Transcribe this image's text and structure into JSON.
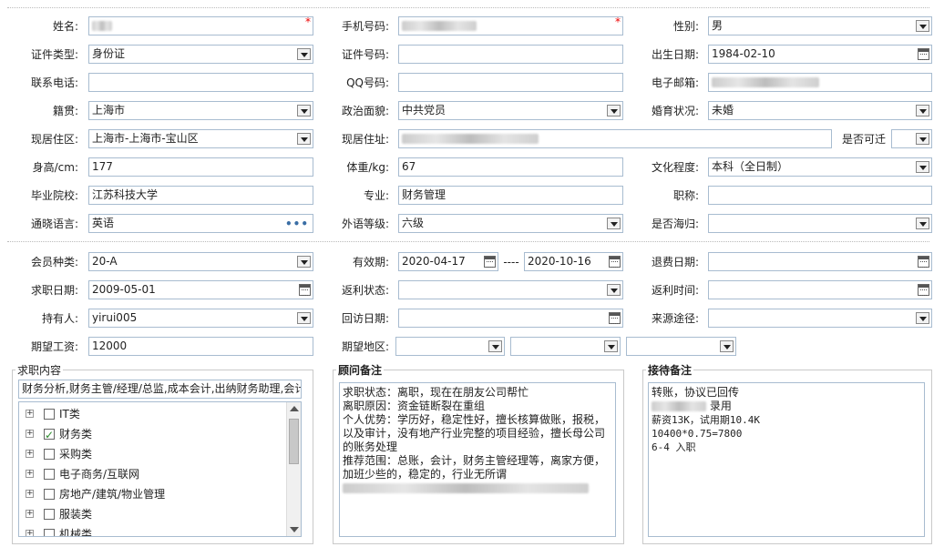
{
  "basic": {
    "name_label": "姓名:",
    "phone_label": "手机号码:",
    "gender_label": "性别:",
    "gender_value": "男",
    "id_type_label": "证件类型:",
    "id_type_value": "身份证",
    "id_no_label": "证件号码:",
    "birth_label": "出生日期:",
    "birth_value": "1984-02-10",
    "contact_label": "联系电话:",
    "qq_label": "QQ号码:",
    "email_label": "电子邮箱:",
    "native_label": "籍贯:",
    "native_value": "上海市",
    "political_label": "政治面貌:",
    "political_value": "中共党员",
    "marital_label": "婚育状况:",
    "marital_value": "未婚",
    "region_label": "现居住区:",
    "region_value": "上海市-上海市-宝山区",
    "address_label": "现居住址:",
    "migrate_label": "是否可迁",
    "height_label": "身高/cm:",
    "height_value": "177",
    "weight_label": "体重/kg:",
    "weight_value": "67",
    "edu_label": "文化程度:",
    "edu_value": "本科（全日制）",
    "school_label": "毕业院校:",
    "school_value": "江苏科技大学",
    "major_label": "专业:",
    "major_value": "财务管理",
    "title_label": "职称:",
    "lang_label": "通晓语言:",
    "lang_value": "英语",
    "lang_more": "•••",
    "lang_level_label": "外语等级:",
    "lang_level_value": "六级",
    "overseas_label": "是否海归:"
  },
  "member": {
    "type_label": "会员种类:",
    "type_value": "20-A",
    "validity_label": "有效期:",
    "valid_from": "2020-04-17",
    "valid_sep": "----",
    "valid_to": "2020-10-16",
    "refund_date_label": "退费日期:",
    "job_date_label": "求职日期:",
    "job_date_value": "2009-05-01",
    "rebate_status_label": "返利状态:",
    "rebate_time_label": "返利时间:",
    "holder_label": "持有人:",
    "holder_value": "yirui005",
    "visit_date_label": "回访日期:",
    "source_label": "来源途径:",
    "salary_label": "期望工资:",
    "salary_value": "12000",
    "area_label": "期望地区:"
  },
  "job": {
    "title": "求职内容",
    "summary": "财务分析,财务主管/经理/总监,成本会计,出纳财务助理,会计",
    "tree": [
      {
        "label": "IT类",
        "checked": false
      },
      {
        "label": "财务类",
        "checked": true
      },
      {
        "label": "采购类",
        "checked": false
      },
      {
        "label": "电子商务/互联网",
        "checked": false
      },
      {
        "label": "房地产/建筑/物业管理",
        "checked": false
      },
      {
        "label": "服装类",
        "checked": false
      },
      {
        "label": "机械类",
        "checked": false
      }
    ],
    "expander": "+"
  },
  "consultant": {
    "title": "顾问备注",
    "lines": [
      "求职状态：离职，现在在朋友公司帮忙",
      "离职原因：资金链断裂在重组",
      "个人优势：学历好，稳定性好，擅长核算做账，报税，以及审计，没有地产行业完整的项目经验，擅长母公司的账务处理",
      "推荐范围：总账，会计，财务主管经理等，离家方便，加班少些的，稳定的，行业无所谓"
    ]
  },
  "reception": {
    "title": "接待备注",
    "line1": "转账，协议已回传",
    "line2_suffix": "录用",
    "line3": "薪资13K，试用期10.4K",
    "line4": "10400*0.75=7800",
    "line5": "6-4 入职"
  },
  "colors": {
    "border": "#a8bcd0",
    "required": "#e00000",
    "check": "#2a8a2a"
  }
}
